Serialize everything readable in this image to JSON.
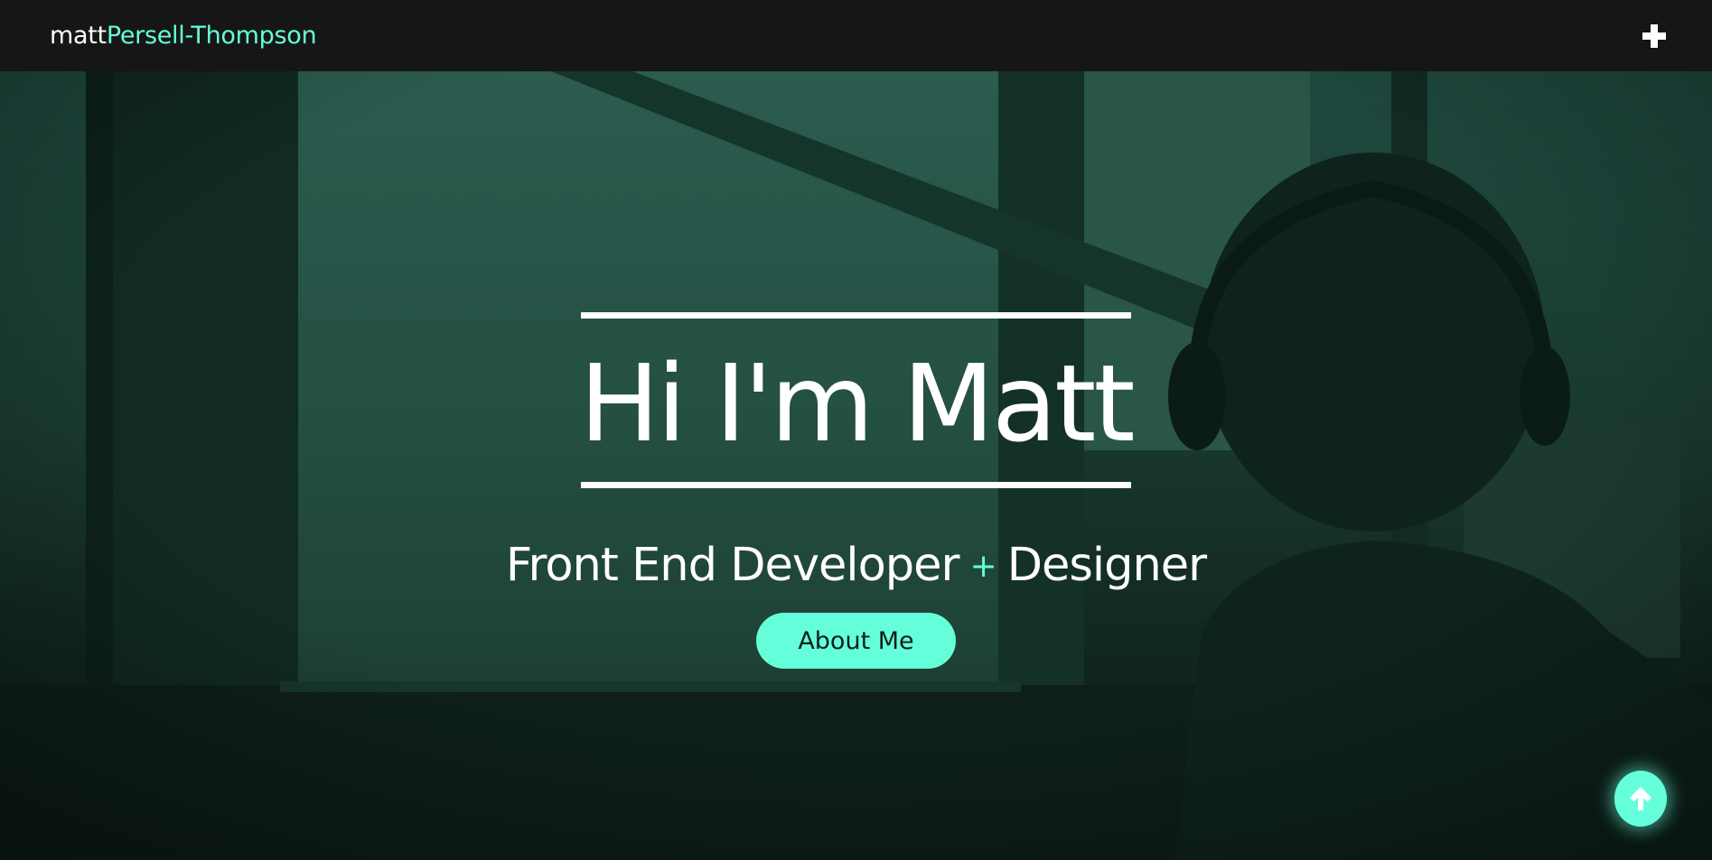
{
  "navbar": {
    "logo_first": "matt",
    "logo_last": "Persell-Thompson",
    "menu_icon": "plus-icon"
  },
  "hero": {
    "title": "Hi I'm Matt",
    "subtitle_part1": "Front End Developer",
    "subtitle_plus": "+",
    "subtitle_part2": "Designer",
    "about_button_label": "About Me",
    "background_image": "person-with-headphones-at-window-silhouette"
  },
  "scroll_top": {
    "icon": "arrow-up-icon"
  },
  "colors": {
    "accent": "#64ffda",
    "navbar_bg": "#161616",
    "hero_overlay": "#1f4a3f",
    "text": "#ffffff"
  }
}
